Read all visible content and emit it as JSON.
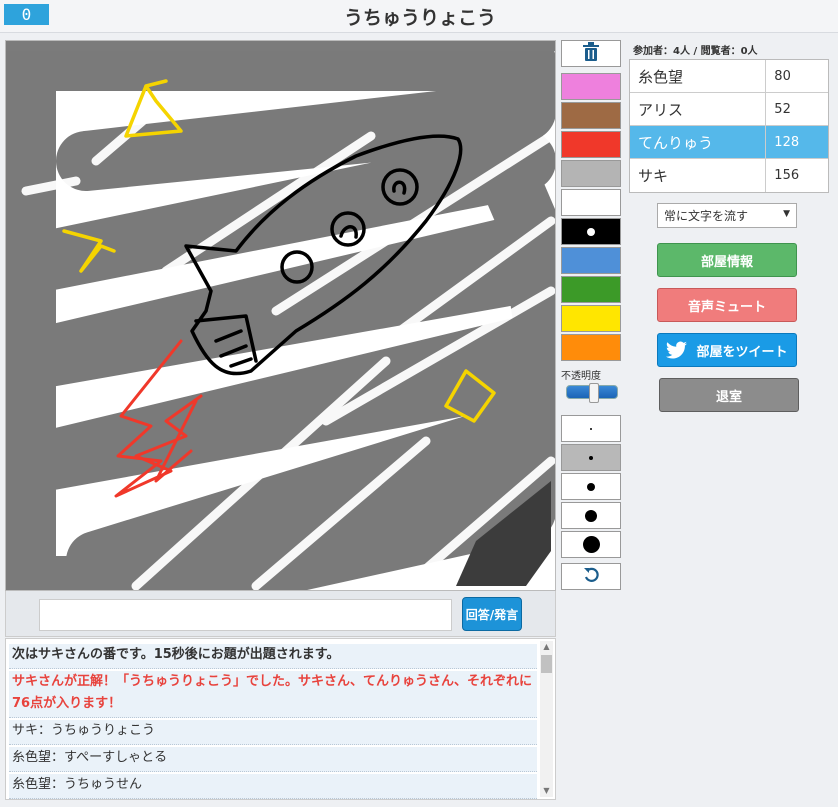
{
  "header": {
    "timer": "0",
    "title": "うちゅうりょこう"
  },
  "tools": {
    "colors": [
      "#ee80dd",
      "#9e6a44",
      "#f0382a",
      "#b4b4b4",
      "#ffffff",
      "#000000",
      "#4f90d8",
      "#3c9a28",
      "#ffe600",
      "#ff8c0a"
    ],
    "opacity_label": "不透明度",
    "opacity_value": 0.55,
    "brush_sizes": [
      1,
      2,
      3,
      4,
      5
    ],
    "icons": {
      "trash": "trash-icon",
      "undo": "undo-icon"
    }
  },
  "counts_label": "参加者：4人 / 閲覧者：0人",
  "scoreboard": [
    {
      "name": "糸色望",
      "score": "80",
      "active": false
    },
    {
      "name": "アリス",
      "score": "52",
      "active": false
    },
    {
      "name": "てんりゅう",
      "score": "128",
      "active": true
    },
    {
      "name": "サキ",
      "score": "156",
      "active": false
    }
  ],
  "options": {
    "scroll_select": "常に文字を流す",
    "room_info": "部屋情報",
    "mute": "音声ミュート",
    "tweet": "部屋をツイート",
    "leave": "退室"
  },
  "input": {
    "value": "",
    "button_label": "回答/発言"
  },
  "chat": [
    {
      "text": "次はサキさんの番です。15秒後にお題が出題されます。",
      "kind": "system"
    },
    {
      "text": "サキさんが正解！「うちゅうりょこう」でした。サキさん、てんりゅうさん、それぞれに76点が入ります！",
      "kind": "correct"
    },
    {
      "text": "サキ：うちゅうりょこう",
      "kind": "normal"
    },
    {
      "text": "糸色望：すぺーすしゃとる",
      "kind": "normal"
    },
    {
      "text": "糸色望：うちゅうせん",
      "kind": "normal"
    }
  ],
  "colors": {
    "accent": "#2ea3dc",
    "correct_text": "#e8433d",
    "active_row": "#55b8ea"
  }
}
